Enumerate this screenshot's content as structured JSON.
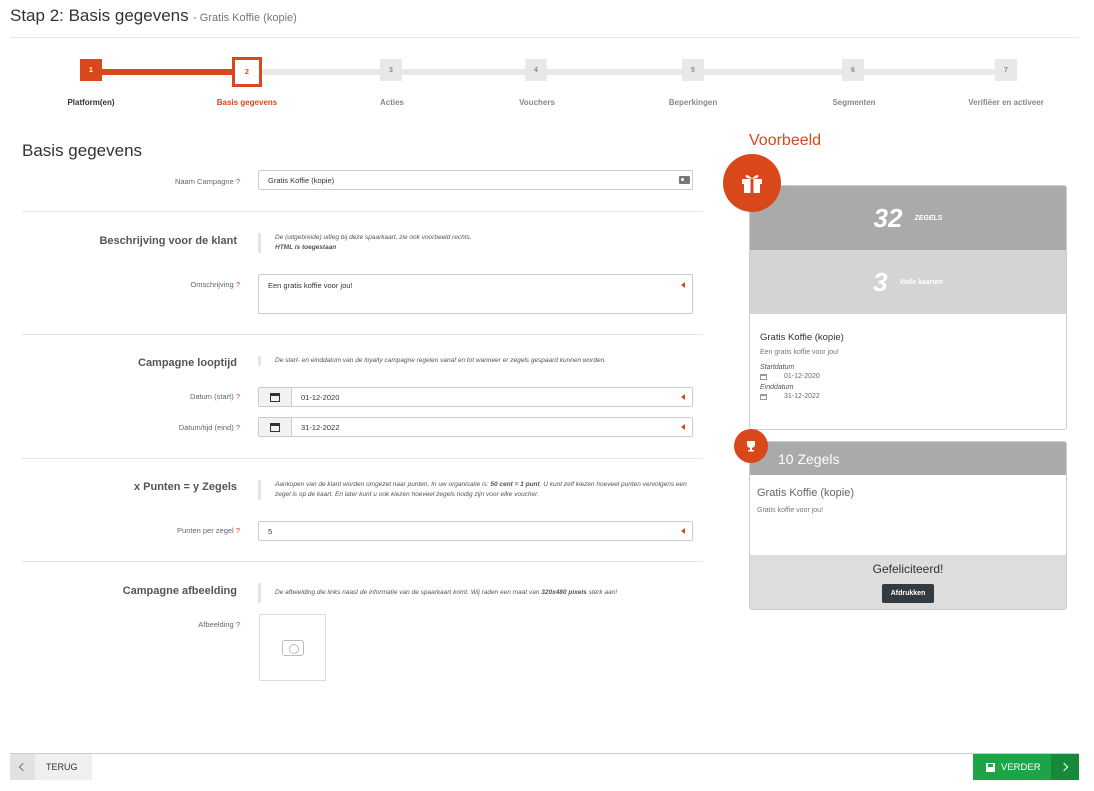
{
  "header": {
    "title": "Stap 2: Basis gegevens",
    "subtitle": "- Gratis Koffie (kopie)"
  },
  "stepper": {
    "steps": [
      {
        "num": "1",
        "label": "Platform(en)",
        "state": "done"
      },
      {
        "num": "2",
        "label": "Basis gegevens",
        "state": "active"
      },
      {
        "num": "3",
        "label": "Acties",
        "state": "todo"
      },
      {
        "num": "4",
        "label": "Vouchers",
        "state": "todo"
      },
      {
        "num": "5",
        "label": "Beperkingen",
        "state": "todo"
      },
      {
        "num": "6",
        "label": "Segmenten",
        "state": "todo"
      },
      {
        "num": "7",
        "label": "Verifiëer en activeer",
        "state": "todo"
      }
    ]
  },
  "form": {
    "title": "Basis gegevens",
    "req_mark": "?",
    "naam_label": "Naam Campagne",
    "naam_value": "Gratis Koffie (kopie)",
    "desc_section": "Beschrijving voor de klant",
    "desc_help1": "De (uitgebreide) uitleg bij deze spaarkaart, zie ook voorbeeld rechts.",
    "desc_help2": "HTML is toegestaan",
    "omschrijving_label": "Omschrijving",
    "omschrijving_value": "Een gratis koffie voor jou!",
    "looptijd_section": "Campagne looptijd",
    "looptijd_help": "De start- en einddatum van de loyalty campagne regelen vanaf en tot wanneer er zegels gespaard kunnen worden.",
    "start_label": "Datum (start)",
    "start_value": "01-12-2020",
    "eind_label": "Datum/tijd (eind)",
    "eind_value": "31-12-2022",
    "punten_section": "x Punten = y Zegels",
    "punten_help_a": "Aankopen van de klant worden omgezet naar punten. In uw organisatie is: ",
    "punten_help_bold": "50 cent = 1 punt",
    "punten_help_b": ". U kunt zelf kiezen hoeveel punten vervolgens een zegel is op de kaart. En later kunt u ook kiezen hoeveel zegels nodig zijn voor elke voucher.",
    "punten_label": "Punten per zegel",
    "punten_value": "5",
    "afbeelding_section": "Campagne afbeelding",
    "afbeelding_help_a": "De afbeelding die links naast de informatie van de spaarkaart komt. Wij raden een maat van ",
    "afbeelding_help_bold": "320x480 pixels",
    "afbeelding_help_b": " sterk aan!",
    "afbeelding_label": "Afbeelding"
  },
  "preview": {
    "title": "Voorbeeld",
    "zegels_count": "32",
    "zegels_unit": "ZEGELS",
    "kaarten_count": "3",
    "kaarten_unit": "Volle kaarten",
    "card_name": "Gratis Koffie (kopie)",
    "card_desc": "Een gratis koffie voor jou!",
    "start_label": "Startdatum",
    "start_value": "01-12-2020",
    "eind_label": "Einddatum",
    "eind_value": "31-12-2022",
    "voucher_header": "10 Zegels",
    "voucher_name": "Gratis Koffie (kopie)",
    "voucher_desc": "Gratis koffie voor jou!",
    "congrats": "Gefeliciteerd!",
    "print_label": "Afdrukken"
  },
  "footer": {
    "back_label": "TERUG",
    "next_label": "VERDER"
  },
  "colors": {
    "accent": "#d9481a",
    "success": "#1ea347",
    "band_dark": "#aaaaaa",
    "band_light": "#d4d4d4"
  },
  "icons": [
    "calendar-icon",
    "id-card-icon",
    "gift-icon",
    "trophy-icon",
    "camera-icon",
    "save-icon",
    "chevron-left-icon",
    "chevron-right-icon"
  ]
}
